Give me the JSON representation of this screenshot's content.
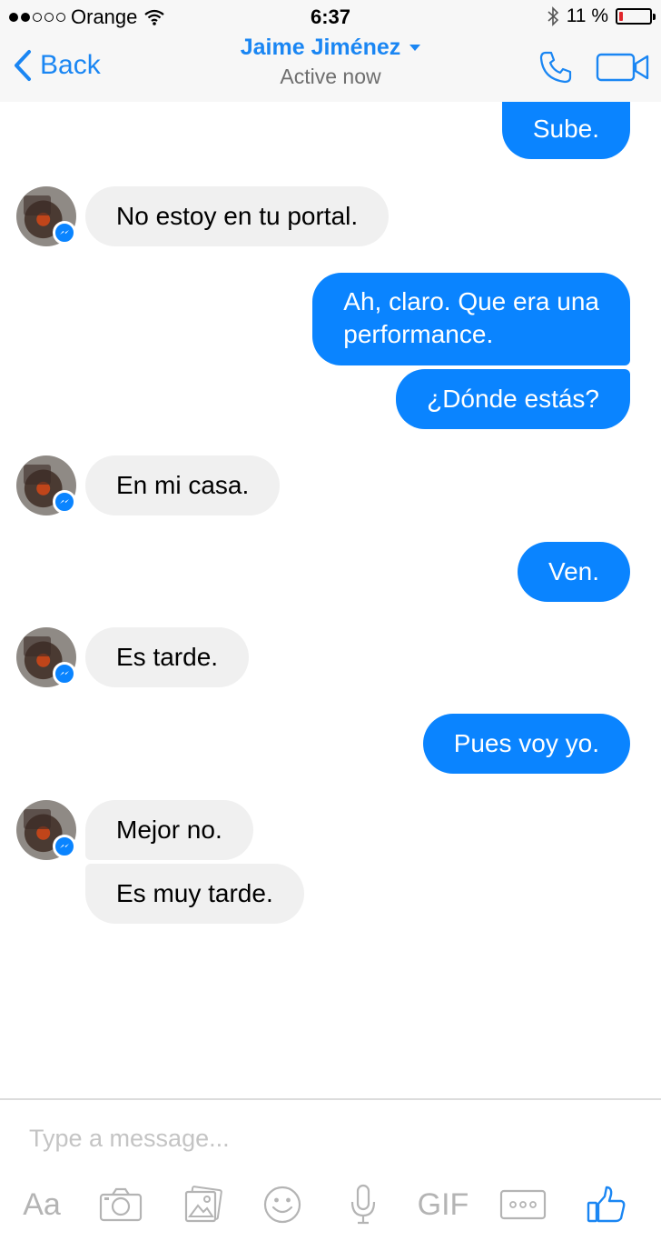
{
  "status_bar": {
    "carrier": "Orange",
    "time": "6:37",
    "battery_percent": "11 %",
    "battery_level": 0.11
  },
  "header": {
    "back_label": "Back",
    "contact_name": "Jaime Jiménez",
    "status": "Active now"
  },
  "messages": [
    {
      "direction": "outgoing",
      "text": "Sube."
    },
    {
      "direction": "incoming",
      "text": "No estoy en tu portal."
    },
    {
      "direction": "outgoing",
      "lines": [
        "Ah, claro. Que era una",
        "performance."
      ]
    },
    {
      "direction": "outgoing",
      "text": "¿Dónde estás?"
    },
    {
      "direction": "incoming",
      "text": "En mi casa."
    },
    {
      "direction": "outgoing",
      "text": "Ven."
    },
    {
      "direction": "incoming",
      "text": "Es tarde."
    },
    {
      "direction": "outgoing",
      "text": "Pues voy yo."
    },
    {
      "direction": "incoming",
      "text": "Mejor no."
    },
    {
      "direction": "incoming",
      "text": "Es muy tarde."
    }
  ],
  "composer": {
    "placeholder": "Type a message...",
    "tools": [
      {
        "icon": "text-format-icon",
        "label": "Aa"
      },
      {
        "icon": "camera-icon"
      },
      {
        "icon": "gallery-icon"
      },
      {
        "icon": "emoji-icon"
      },
      {
        "icon": "microphone-icon"
      },
      {
        "icon": "gif-icon",
        "label": "GIF"
      },
      {
        "icon": "more-icon"
      },
      {
        "icon": "thumbs-up-icon"
      }
    ]
  },
  "colors": {
    "accent": "#1a86f3",
    "outgoing_bubble": "#0a84ff",
    "incoming_bubble": "#f0f0f0",
    "battery_low": "#e0262b",
    "toolbar_icon": "#b4b4b4"
  }
}
